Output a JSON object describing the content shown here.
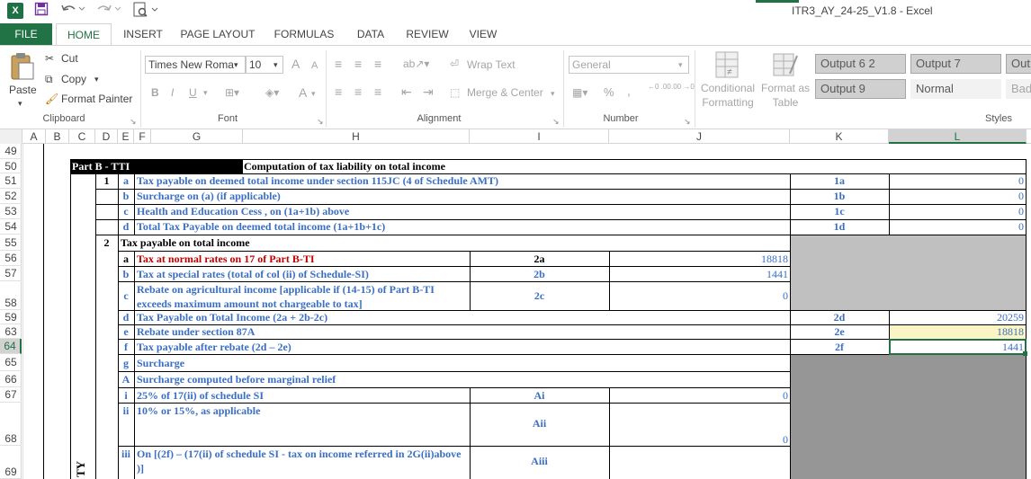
{
  "window": {
    "title": "ITR3_AY_24-25_V1.8 - Excel"
  },
  "qat": {
    "logo": "X",
    "save": "save-icon",
    "undo": "undo-icon",
    "redo": "redo-icon",
    "preview": "print-preview-icon"
  },
  "ribbon_tabs": [
    "FILE",
    "HOME",
    "INSERT",
    "PAGE LAYOUT",
    "FORMULAS",
    "DATA",
    "REVIEW",
    "VIEW"
  ],
  "clipboard": {
    "paste": "Paste",
    "cut": "Cut",
    "copy": "Copy",
    "format_painter": "Format Painter",
    "label": "Clipboard"
  },
  "font": {
    "name": "Times New Roma",
    "size": "10",
    "bold": "B",
    "italic": "I",
    "underline": "U",
    "label": "Font",
    "grow": "A",
    "shrink": "A",
    "color": "A"
  },
  "alignment": {
    "wrap": "Wrap Text",
    "merge": "Merge & Center",
    "label": "Alignment"
  },
  "number": {
    "format": "General",
    "percent": "%",
    "comma": ",",
    "label": "Number",
    "inc": "←0 .00",
    "dec": ".00 →0"
  },
  "styles": {
    "conditional": "Conditional Formatting",
    "format_table": "Format as Table",
    "cells": [
      "Output 6 2",
      "Output 7",
      "Out",
      "Output 9",
      "Normal",
      "Bad"
    ],
    "label": "Styles"
  },
  "columns": [
    "A",
    "B",
    "C",
    "D",
    "E",
    "F",
    "G",
    "H",
    "I",
    "J",
    "K",
    "L"
  ],
  "rows": [
    "49",
    "50",
    "51",
    "52",
    "53",
    "54",
    "55",
    "56",
    "57",
    "58",
    "59",
    "63",
    "64",
    "65",
    "66",
    "67",
    "68",
    "69"
  ],
  "sheet": {
    "part": "Part B - TTI",
    "heading": "Computation of tax liability on total income",
    "r51": {
      "no": "1",
      "sub": "a",
      "text": "Tax payable on deemed total income under section 115JC (4 of Schedule AMT)",
      "code": "1a",
      "val": "0"
    },
    "r52": {
      "sub": "b",
      "text": "Surcharge on (a) (if applicable)",
      "code": "1b",
      "val": "0"
    },
    "r53": {
      "sub": "c",
      "text": "Health and Education Cess ,  on (1a+1b) above",
      "code": "1c",
      "val": "0"
    },
    "r54": {
      "sub": "d",
      "text": "Total Tax Payable on deemed total income (1a+1b+1c)",
      "code": "1d",
      "val": "0"
    },
    "r55": {
      "no": "2",
      "text": "Tax payable on total income"
    },
    "r56": {
      "sub": "a",
      "text": "Tax at normal rates on 17 of Part B-TI",
      "code": "2a",
      "val": "18818"
    },
    "r57": {
      "sub": "b",
      "text": "Tax at special rates (total of  col (ii) of Schedule-SI)",
      "code": "2b",
      "val": "1441"
    },
    "r58": {
      "sub": "c",
      "text": "Rebate on agricultural income [applicable if (14-15) of Part B-TI exceeds maximum amount not chargeable to tax]",
      "code": "2c",
      "val": "0"
    },
    "r59": {
      "sub": "d",
      "text": "Tax Payable on Total Income (2a + 2b-2c)",
      "code": "2d",
      "val": "20259"
    },
    "r63": {
      "sub": "e",
      "text": "Rebate under section 87A",
      "code": "2e",
      "val": "18818"
    },
    "r64": {
      "sub": "f",
      "text": "Tax payable after rebate (2d – 2e)",
      "code": "2f",
      "val": "1441"
    },
    "r65": {
      "sub": "g",
      "text": "Surcharge"
    },
    "r66": {
      "sub": "A",
      "text": "Surcharge computed before marginal relief"
    },
    "r67": {
      "sub": "i",
      "text": "25% of 17(ii) of schedule SI",
      "code": "Ai",
      "val": "0"
    },
    "r68": {
      "sub": "ii",
      "text": "10% or 15%, as applicable",
      "code": "Aii",
      "val": "0"
    },
    "r69": {
      "sub": "iii",
      "text": "On [(2f) – (17(ii)  of schedule SI - tax on income referred in 2G(ii)above )]",
      "code": "Aiii"
    },
    "side": "TY"
  },
  "colors": {
    "excel_green": "#217346",
    "cell_text": "#3a6fc4",
    "red_text": "#c00000",
    "shade": "#c0c0c0",
    "dark_shade": "#969696",
    "highlight": "#fbf5c5"
  }
}
